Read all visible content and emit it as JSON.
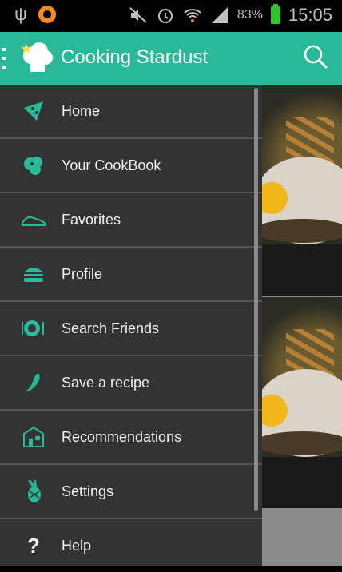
{
  "status_bar": {
    "battery_pct": "83%",
    "time": "15:05"
  },
  "app_bar": {
    "title": "Cooking Stardust"
  },
  "drawer": {
    "items": [
      {
        "label": "Home",
        "icon": "pizza-slice-icon"
      },
      {
        "label": "Your CookBook",
        "icon": "cookbook-icon"
      },
      {
        "label": "Favorites",
        "icon": "shoe-icon"
      },
      {
        "label": "Profile",
        "icon": "burger-icon"
      },
      {
        "label": "Search Friends",
        "icon": "plate-cutlery-icon"
      },
      {
        "label": "Save a recipe",
        "icon": "chili-pepper-icon"
      },
      {
        "label": "Recommendations",
        "icon": "shop-building-icon"
      },
      {
        "label": "Settings",
        "icon": "pineapple-icon"
      },
      {
        "label": "Help",
        "icon": "question-mark-icon"
      }
    ]
  },
  "colors": {
    "accent": "#2ab998",
    "drawer_bg": "#333333",
    "divider": "#555555"
  }
}
